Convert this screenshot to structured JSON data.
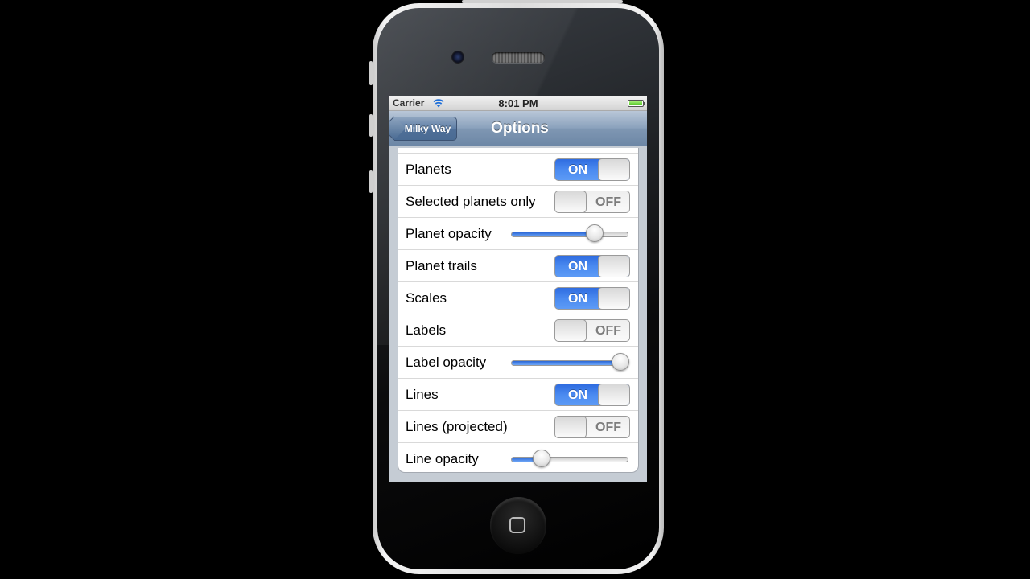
{
  "statusbar": {
    "carrier": "Carrier",
    "wifi_icon": "wifi-icon",
    "time": "8:01 PM",
    "battery_icon": "battery-icon"
  },
  "navbar": {
    "back_label": "Milky Way",
    "title": "Options"
  },
  "rows": [
    {
      "label": "Planets",
      "type": "switch",
      "state": "ON"
    },
    {
      "label": "Selected planets only",
      "type": "switch",
      "state": "OFF"
    },
    {
      "label": "Planet opacity",
      "type": "slider",
      "value": 0.71
    },
    {
      "label": "Planet trails",
      "type": "switch",
      "state": "ON"
    },
    {
      "label": "Scales",
      "type": "switch",
      "state": "ON"
    },
    {
      "label": "Labels",
      "type": "switch",
      "state": "OFF"
    },
    {
      "label": "Label opacity",
      "type": "slider",
      "value": 0.93
    },
    {
      "label": "Lines",
      "type": "switch",
      "state": "ON"
    },
    {
      "label": "Lines (projected)",
      "type": "switch",
      "state": "OFF"
    },
    {
      "label": "Line opacity",
      "type": "slider",
      "value": 0.26
    }
  ],
  "colors": {
    "switch_on": "#3c7ded",
    "navbar": "#8aa1bc",
    "table_background": "#c5ccd4"
  }
}
